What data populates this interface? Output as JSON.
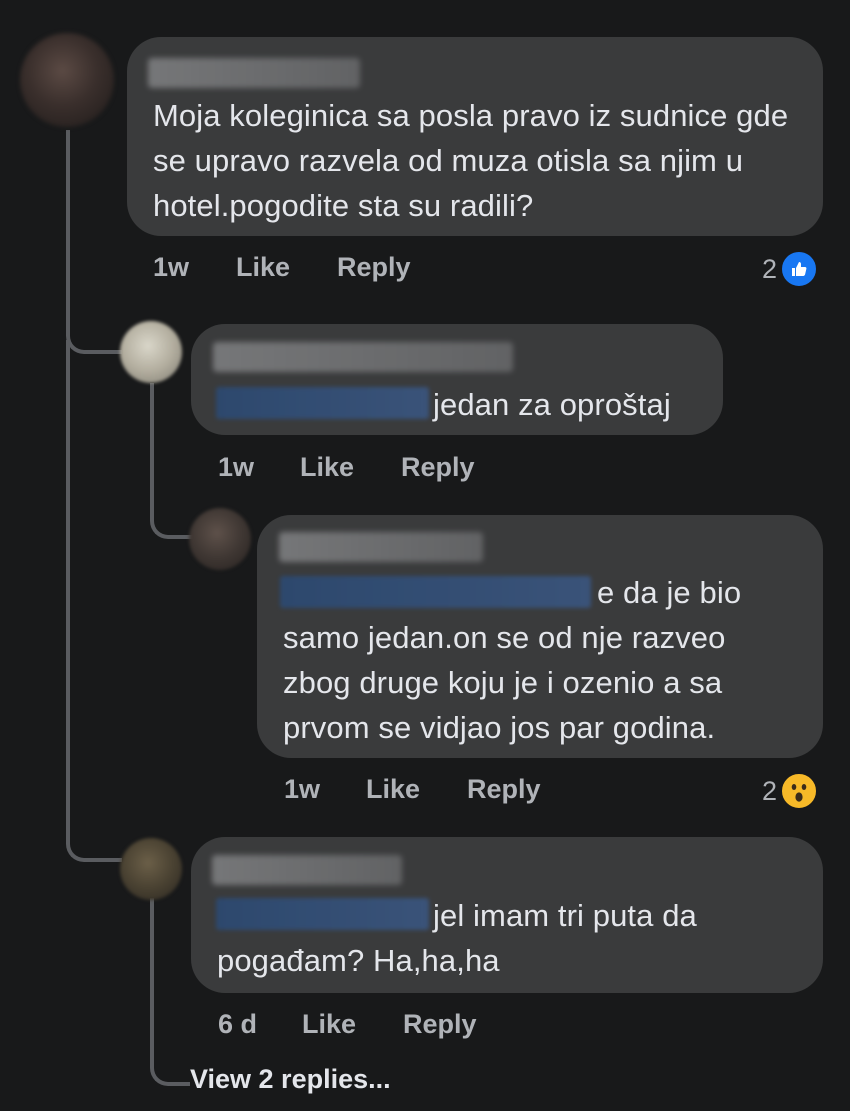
{
  "comments": [
    {
      "text": "Moja koleginica sa posla pravo iz sudnice gde se upravo razvela od muza otisla sa njim u hotel.pogodite sta su radili?",
      "time": "1w",
      "like_label": "Like",
      "reply_label": "Reply",
      "reaction_count": "2",
      "reaction_icon": "like-icon",
      "reaction_color": "#1877f2"
    },
    {
      "text": "jedan za oproštaj",
      "time": "1w",
      "like_label": "Like",
      "reply_label": "Reply"
    },
    {
      "text_line1": "e da je bio",
      "text_rest": "samo jedan.on se od nje razveo zbog druge koju je i ozenio a sa prvom se vidjao jos par godina.",
      "time": "1w",
      "like_label": "Like",
      "reply_label": "Reply",
      "reaction_count": "2",
      "reaction_icon": "wow-icon",
      "reaction_color": "#f7b928"
    },
    {
      "text_line1": "jel imam tri puta da",
      "text_rest": "pogađam? Ha,ha,ha",
      "time": "6 d",
      "like_label": "Like",
      "reply_label": "Reply"
    }
  ],
  "view_replies_label": "View 2 replies..."
}
